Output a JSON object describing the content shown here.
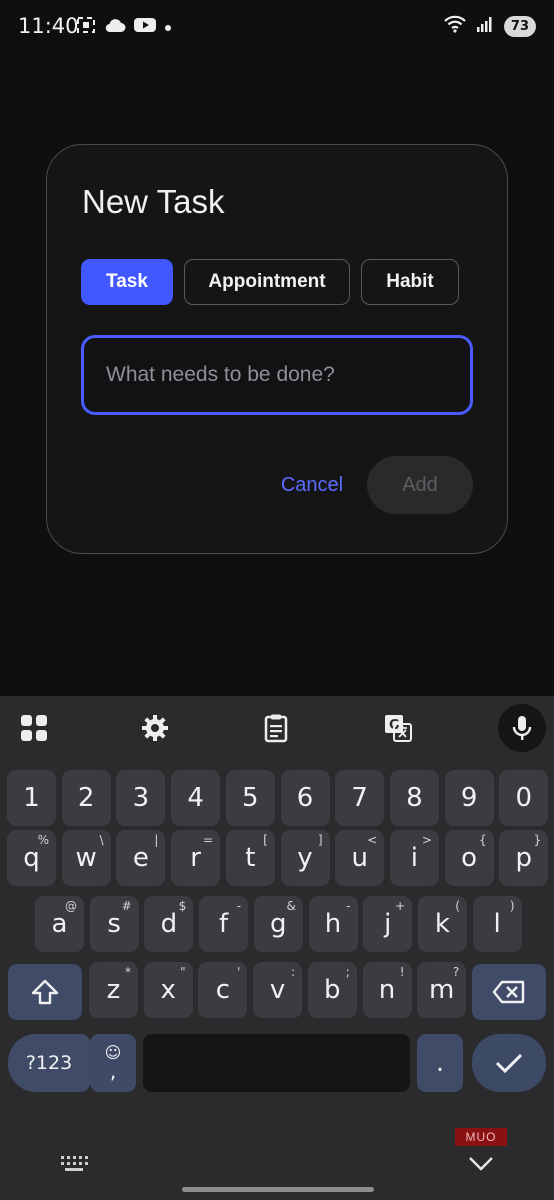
{
  "status_bar": {
    "time": "11:40",
    "battery": "73",
    "icons": [
      "screenshot-icon",
      "cloud-icon",
      "youtube-icon",
      "dot-icon",
      "wifi-icon",
      "signal-icon"
    ]
  },
  "dialog": {
    "title": "New Task",
    "tabs": [
      {
        "label": "Task",
        "selected": true
      },
      {
        "label": "Appointment",
        "selected": false
      },
      {
        "label": "Habit",
        "selected": false
      }
    ],
    "input_placeholder": "What needs to be done?",
    "cancel_label": "Cancel",
    "add_label": "Add",
    "accent_color": "#4157ff"
  },
  "keyboard": {
    "toolbar_icons": [
      "apps-grid-icon",
      "settings-gear-icon",
      "clipboard-icon",
      "translate-icon",
      "microphone-icon"
    ],
    "row_numbers": [
      "1",
      "2",
      "3",
      "4",
      "5",
      "6",
      "7",
      "8",
      "9",
      "0"
    ],
    "row1": [
      {
        "k": "q",
        "h": "%"
      },
      {
        "k": "w",
        "h": "\\"
      },
      {
        "k": "e",
        "h": "|"
      },
      {
        "k": "r",
        "h": "="
      },
      {
        "k": "t",
        "h": "["
      },
      {
        "k": "y",
        "h": "]"
      },
      {
        "k": "u",
        "h": "<"
      },
      {
        "k": "i",
        "h": ">"
      },
      {
        "k": "o",
        "h": "{"
      },
      {
        "k": "p",
        "h": "}"
      }
    ],
    "row2": [
      {
        "k": "a",
        "h": "@"
      },
      {
        "k": "s",
        "h": "#"
      },
      {
        "k": "d",
        "h": "$"
      },
      {
        "k": "f",
        "h": "-"
      },
      {
        "k": "g",
        "h": "&"
      },
      {
        "k": "h",
        "h": "-"
      },
      {
        "k": "j",
        "h": "+"
      },
      {
        "k": "k",
        "h": "("
      },
      {
        "k": "l",
        "h": ")"
      }
    ],
    "row3": [
      {
        "k": "z",
        "h": "*"
      },
      {
        "k": "x",
        "h": "\""
      },
      {
        "k": "c",
        "h": "'"
      },
      {
        "k": "v",
        "h": ":"
      },
      {
        "k": "b",
        "h": ";"
      },
      {
        "k": "n",
        "h": "!"
      },
      {
        "k": "m",
        "h": "?"
      }
    ],
    "symbols_label": "?123",
    "emoji_comma_label": ",",
    "period_label": "."
  },
  "watermark": "MUO"
}
